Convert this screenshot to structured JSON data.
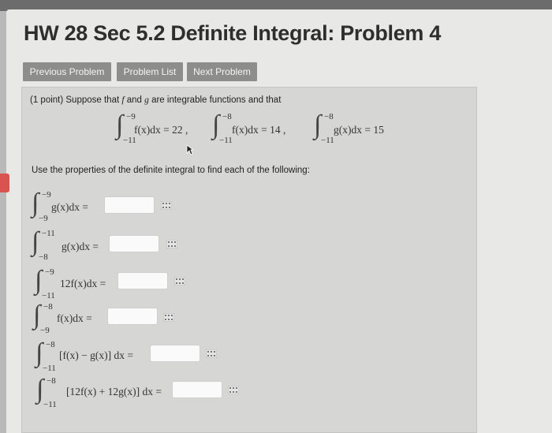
{
  "header": {
    "title": "HW 28 Sec 5.2 Definite Integral: Problem 4"
  },
  "nav": {
    "previous": "Previous Problem",
    "list": "Problem List",
    "next": "Next Problem"
  },
  "problem": {
    "intro_points": "(1 point)",
    "intro_a": " Suppose that ",
    "intro_f": "f",
    "intro_and": " and ",
    "intro_g": "g",
    "intro_b": " are integrable functions and that",
    "instruction": "Use the properties of the definite integral to find each of the following:",
    "given": [
      {
        "upper": "−9",
        "lower": "−11",
        "expr": "f(x)dx = 22 ,"
      },
      {
        "upper": "−8",
        "lower": "−11",
        "expr": "f(x)dx = 14 ,"
      },
      {
        "upper": "−8",
        "lower": "−11",
        "expr": "g(x)dx = 15"
      }
    ],
    "questions": [
      {
        "upper": "−9",
        "lower": "−9",
        "expr": "g(x)dx =",
        "value": ""
      },
      {
        "upper": "−11",
        "lower": "−8",
        "expr": "g(x)dx =",
        "value": ""
      },
      {
        "upper": "−9",
        "lower": "−11",
        "expr": "12f(x)dx =",
        "value": ""
      },
      {
        "upper": "−8",
        "lower": "−9",
        "expr": "f(x)dx =",
        "value": ""
      },
      {
        "upper": "−8",
        "lower": "−11",
        "expr": "[f(x) − g(x)] dx =",
        "value": ""
      },
      {
        "upper": "−8",
        "lower": "−11",
        "expr": "[12f(x) + 12g(x)] dx =",
        "value": ""
      }
    ]
  },
  "icons": {
    "equation_editor": "matrix-icon",
    "side_marker": "red-side-tab"
  },
  "colors": {
    "nav_button": "#8d8d8c",
    "panel": "#d6d6d4",
    "side_tab": "#d9534f"
  }
}
